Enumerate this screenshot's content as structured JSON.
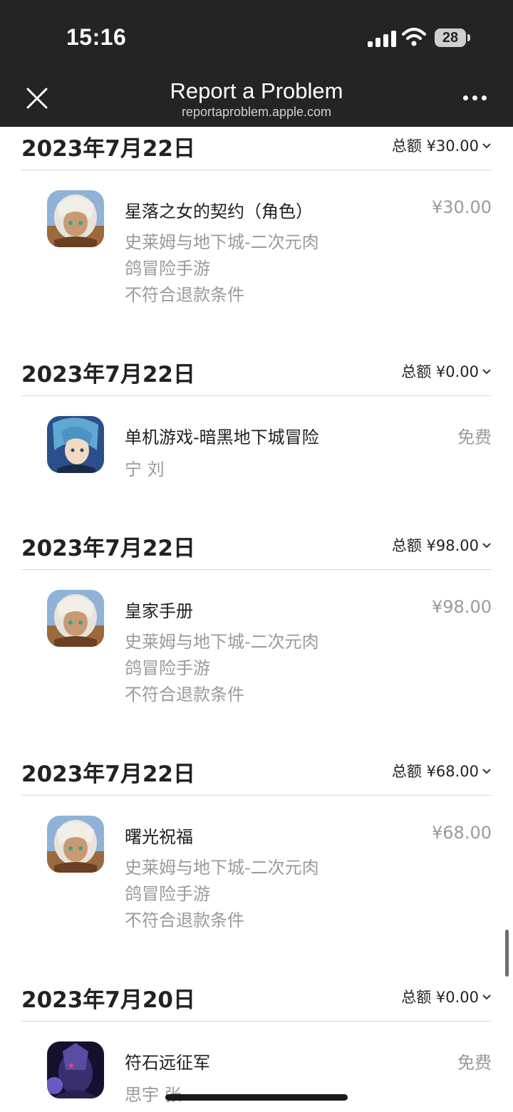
{
  "status_bar": {
    "time": "15:16",
    "battery": "28"
  },
  "header": {
    "title": "Report a Problem",
    "url": "reportaproblem.apple.com"
  },
  "purchases": [
    {
      "date": "2023年7月22日",
      "total": "总额 ¥30.00",
      "item": {
        "name": "星落之女的契约（角色）",
        "publisher_line1": "史莱姆与地下城-二次元肉",
        "publisher_line2": "鸽冒险手游",
        "status": "不符合退款条件",
        "price": "¥30.00",
        "icon": "anime-girl-icon"
      }
    },
    {
      "date": "2023年7月22日",
      "total": "总额 ¥0.00",
      "item": {
        "name": "单机游戏-暗黑地下城冒险",
        "publisher_line1": "宁 刘",
        "price": "免费",
        "icon": "anime-boy-icon"
      }
    },
    {
      "date": "2023年7月22日",
      "total": "总额 ¥98.00",
      "item": {
        "name": "皇家手册",
        "publisher_line1": "史莱姆与地下城-二次元肉",
        "publisher_line2": "鸽冒险手游",
        "status": "不符合退款条件",
        "price": "¥98.00",
        "icon": "anime-girl-icon"
      }
    },
    {
      "date": "2023年7月22日",
      "total": "总额 ¥68.00",
      "item": {
        "name": "曙光祝福",
        "publisher_line1": "史莱姆与地下城-二次元肉",
        "publisher_line2": "鸽冒险手游",
        "status": "不符合退款条件",
        "price": "¥68.00",
        "icon": "anime-girl-icon"
      }
    },
    {
      "date": "2023年7月20日",
      "total": "总额 ¥0.00",
      "item": {
        "name": "符石远征军",
        "publisher_line1": "思宇 张",
        "price": "免费",
        "icon": "dark-knight-icon"
      }
    }
  ]
}
